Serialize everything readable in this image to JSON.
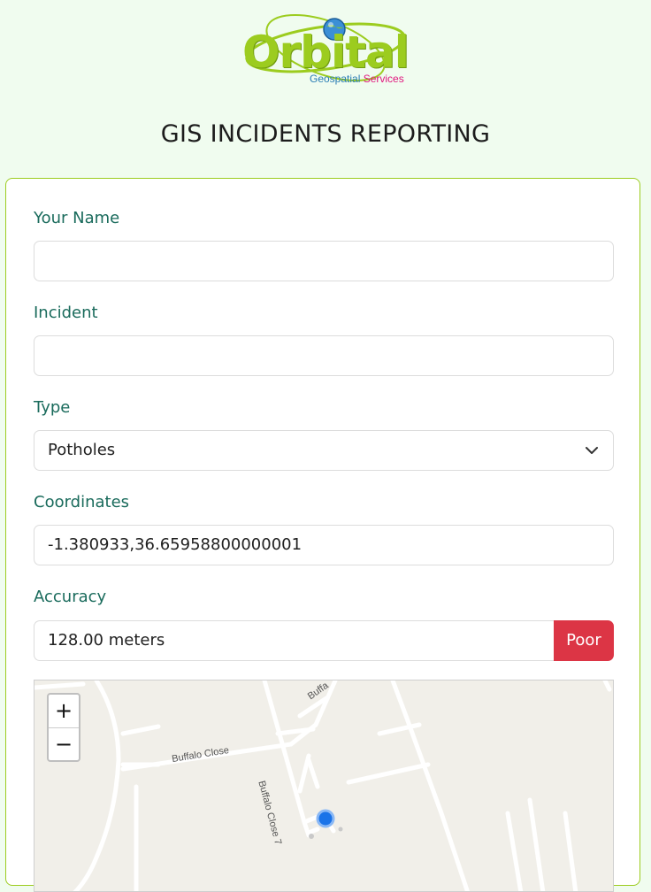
{
  "logo": {
    "word": "Orbital",
    "sub_a": "Geospatial",
    "sub_b": "Services"
  },
  "page": {
    "title": "GIS INCIDENTS REPORTING"
  },
  "form": {
    "name_label": "Your Name",
    "name_value": "",
    "incident_label": "Incident",
    "incident_value": "",
    "type_label": "Type",
    "type_value": "Potholes",
    "coords_label": "Coordinates",
    "coords_value": "-1.380933,36.65958800000001",
    "accuracy_label": "Accuracy",
    "accuracy_value": "128.00 meters",
    "accuracy_badge": "Poor"
  },
  "map": {
    "zoom_in": "+",
    "zoom_out": "−",
    "streets": [
      "Buffalo Close",
      "Buffalo Close 7",
      "Buffa"
    ]
  },
  "colors": {
    "accent_green": "#9ccc1f",
    "label_teal": "#1a6b5c",
    "danger": "#dc3545",
    "background": "#f0fcef",
    "location_dot": "#1a73e8"
  },
  "icons": {
    "select": "chevron-down-icon",
    "location": "location-dot-icon",
    "globe": "globe-icon"
  }
}
